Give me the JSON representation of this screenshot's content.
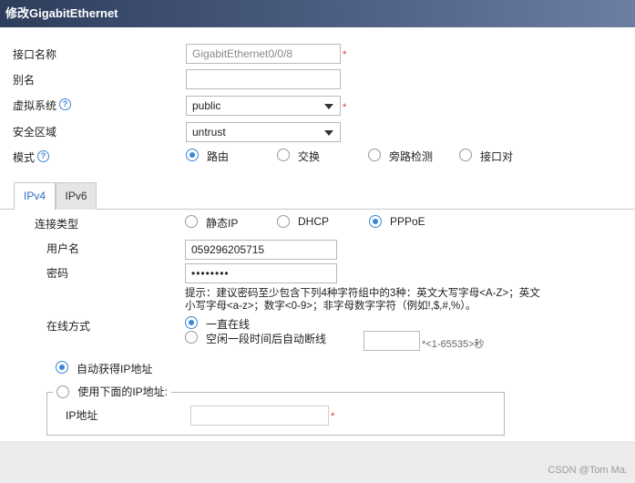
{
  "title": "修改GigabitEthernet",
  "form": {
    "interface_name_label": "接口名称",
    "interface_name_value": "GigabitEthernet0/0/8",
    "alias_label": "别名",
    "alias_value": "",
    "vsys_label": "虚拟系统",
    "vsys_value": "public",
    "zone_label": "安全区域",
    "zone_value": "untrust",
    "mode_label": "模式",
    "mode_options": [
      "路由",
      "交换",
      "旁路检测",
      "接口对"
    ],
    "mode_selected": "路由",
    "required_mark": "*",
    "help_glyph": "?"
  },
  "tabs": [
    "IPv4",
    "IPv6"
  ],
  "ipv4": {
    "conn_type_label": "连接类型",
    "conn_options": [
      "静态IP",
      "DHCP",
      "PPPoE"
    ],
    "conn_selected": "PPPoE",
    "username_label": "用户名",
    "username_value": "059296205715",
    "password_label": "密码",
    "password_value": "••••••••",
    "password_hint": "提示：建议密码至少包含下列4种字符组中的3种：英文大写字母<A-Z>；英文小写字母<a-z>；数字<0-9>；非字母数字字符（例如!,$,#,%）。",
    "online_mode_label": "在线方式",
    "online_options": [
      "一直在线",
      "空闲一段时间后自动断线"
    ],
    "online_selected": "一直在线",
    "idle_range_hint": "*<1-65535>秒",
    "auto_ip_label": "自动获得IP地址",
    "manual_ip_label": "使用下面的IP地址:",
    "ip_address_label": "IP地址",
    "ip_address_value": ""
  },
  "watermark": "CSDN @Tom Ma.",
  "colors": {
    "accent": "#3b86d6",
    "required": "#e03030",
    "titlebar": "#3a4b6d"
  }
}
